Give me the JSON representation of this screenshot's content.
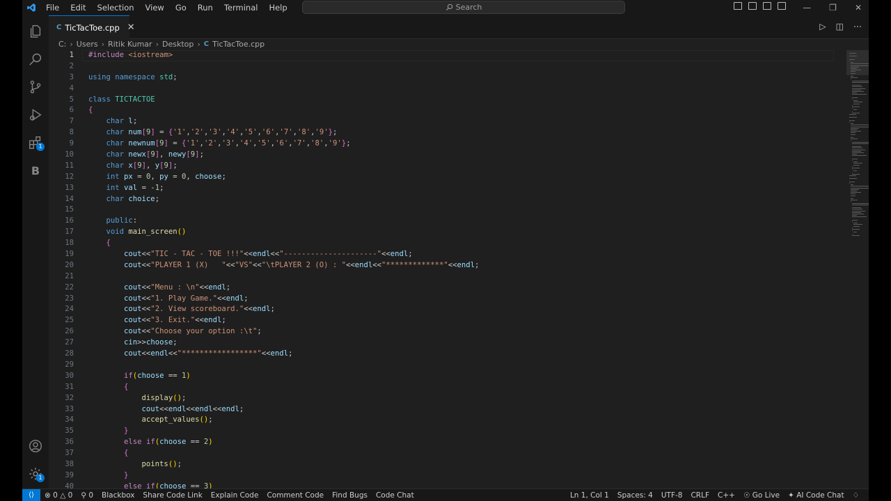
{
  "menu": [
    "File",
    "Edit",
    "Selection",
    "View",
    "Go",
    "Run",
    "Terminal",
    "Help"
  ],
  "search": {
    "placeholder": "Search"
  },
  "tab": {
    "label": "TicTacToe.cpp",
    "icon": "C"
  },
  "breadcrumb": [
    "C:",
    "Users",
    "Ritik Kumar",
    "Desktop",
    "TicTacToe.cpp"
  ],
  "activity": {
    "extensions_badge": "1",
    "manage_badge": "1",
    "blackbox_letter": "B"
  },
  "status": {
    "errors": "0",
    "warnings": "0",
    "ports": "0",
    "items": [
      "Blackbox",
      "Share Code Link",
      "Explain Code",
      "Comment Code",
      "Find Bugs",
      "Code Chat"
    ],
    "position": "Ln 1, Col 1",
    "spaces": "Spaces: 4",
    "encoding": "UTF-8",
    "eol": "CRLF",
    "language": "C++",
    "golive": "Go Live",
    "ai": "AI Code Chat"
  },
  "code": {
    "line_numbers": [
      "1",
      "2",
      "3",
      "4",
      "5",
      "6",
      "7",
      "8",
      "9",
      "10",
      "11",
      "12",
      "13",
      "14",
      "15",
      "16",
      "17",
      "18",
      "19",
      "20",
      "21",
      "22",
      "23",
      "24",
      "25",
      "26",
      "27",
      "28",
      "29",
      "30",
      "31",
      "32",
      "33",
      "34",
      "35",
      "36",
      "37",
      "38",
      "39",
      "40"
    ],
    "lines": [
      "#include <iostream>",
      "",
      "using namespace std;",
      "",
      "class TICTACTOE",
      "{",
      "    char l;",
      "    char num[9] = {'1','2','3','4','5','6','7','8','9'};",
      "    char newnum[9] = {'1','2','3','4','5','6','7','8','9'};",
      "    char newx[9], newy[9];",
      "    char x[9], y[9];",
      "    int px = 0, py = 0, choose;",
      "    int val = -1;",
      "    char choice;",
      "",
      "    public:",
      "    void main_screen()",
      "    {",
      "        cout<<\"TIC - TAC - TOE !!!\"<<endl<<\"---------------------\"<<endl;",
      "        cout<<\"PLAYER 1 (X)   \"<<\"VS\"<<\"\\tPLAYER 2 (O) : \"<<endl<<\"*************\"<<endl;",
      "",
      "        cout<<\"Menu : \\n\"<<endl;",
      "        cout<<\"1. Play Game.\"<<endl;",
      "        cout<<\"2. View scoreboard.\"<<endl;",
      "        cout<<\"3. Exit.\"<<endl;",
      "        cout<<\"Choose your option :\\t\";",
      "        cin>>choose;",
      "        cout<<endl<<\"*****************\"<<endl;",
      "",
      "        if(choose == 1)",
      "        {",
      "            display();",
      "            cout<<endl<<endl<<endl;",
      "            accept_values();",
      "        }",
      "        else if(choose == 2)",
      "        {",
      "            points();",
      "        }",
      "        else if(choose == 3)"
    ]
  }
}
